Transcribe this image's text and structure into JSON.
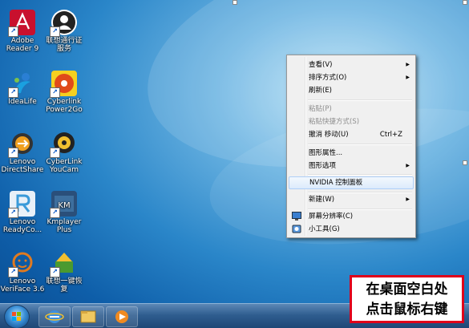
{
  "desktop": {
    "icons": [
      {
        "label": "Adobe\nReader 9",
        "icon": "adobe-reader-icon",
        "color": "#c8102e"
      },
      {
        "label": "联想通行证\n服务",
        "icon": "user-account-icon",
        "color": "#222222"
      },
      {
        "label": "IdeaLife",
        "icon": "idealife-icon",
        "color": "#2a7fd4"
      },
      {
        "label": "Cyberlink\nPower2Go",
        "icon": "cyberlink-power2go-icon",
        "color": "#e04a1a"
      },
      {
        "label": "Lenovo\nDirectShare",
        "icon": "lenovo-directshare-icon",
        "color": "#f0a020"
      },
      {
        "label": "CyberLink\nYouCam",
        "icon": "youcam-icon",
        "color": "#f0c030"
      },
      {
        "label": "Lenovo\nReadyCo...",
        "icon": "lenovo-readycomms-icon",
        "color": "#3a9ad9"
      },
      {
        "label": "Kmplayer\nPlus",
        "icon": "kmplayer-icon",
        "color": "#2a4f7a"
      },
      {
        "label": "Lenovo\nVeriFace 3.6",
        "icon": "veriface-icon",
        "color": "#e07a20"
      },
      {
        "label": "联想一键恢\n复",
        "icon": "onekey-recovery-icon",
        "color": "#4a9a30"
      }
    ]
  },
  "context_menu": {
    "view": "查看(V)",
    "sort": "排序方式(O)",
    "refresh": "刷新(E)",
    "paste": "粘贴(P)",
    "paste_shortcut": "粘贴快捷方式(S)",
    "undo_move": "撤消 移动(U)",
    "undo_shortcut": "Ctrl+Z",
    "graphics_props": "图形属性...",
    "graphics_options": "图形选项",
    "nvidia": "NVIDIA 控制面板",
    "new": "新建(W)",
    "screen_resolution": "屏幕分辨率(C)",
    "gadgets": "小工具(G)"
  },
  "annotation": {
    "line1": "在桌面空白处",
    "line2": "点击鼠标右键"
  },
  "taskbar": {
    "apps": [
      "start-orb",
      "internet-explorer-icon",
      "windows-explorer-icon",
      "media-player-icon"
    ]
  },
  "colors": {
    "menu_highlight": "#dcebfc",
    "annotation_border": "#e0001a",
    "taskbar": "#2f5d8f"
  }
}
